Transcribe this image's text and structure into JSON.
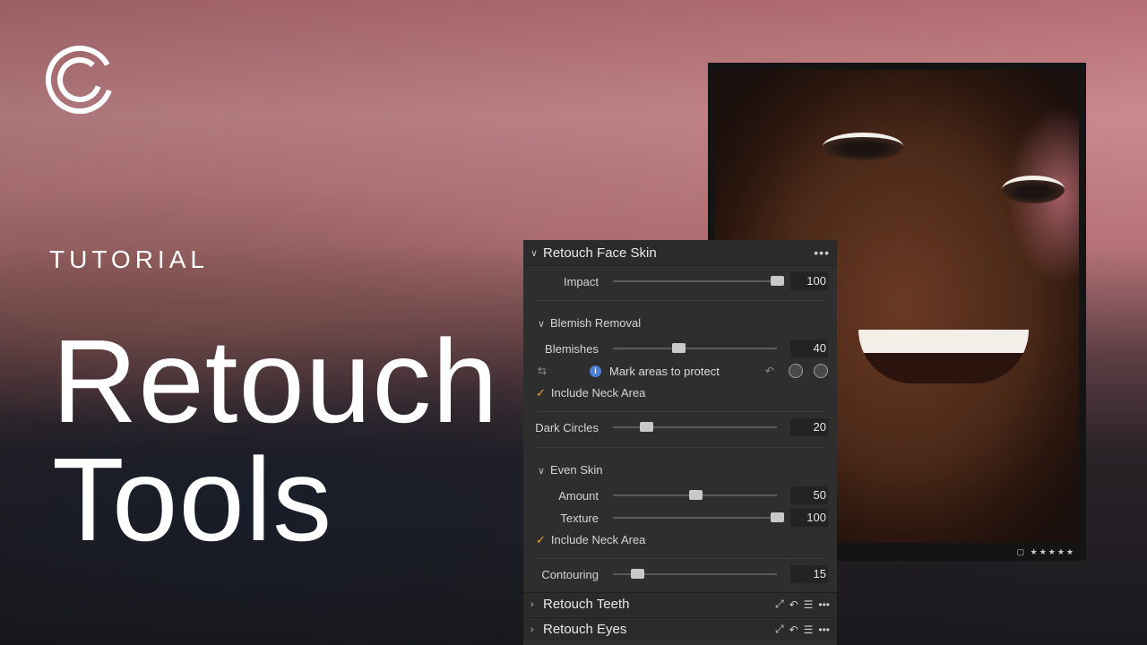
{
  "hero": {
    "tag": "TUTORIAL",
    "title_line1": "Retouch",
    "title_line2": "Tools"
  },
  "photo": {
    "rating": "▢ ★★★★★"
  },
  "panel": {
    "header": "Retouch Face Skin",
    "more": "•••",
    "impact": {
      "label": "Impact",
      "value": "100",
      "level": 1.0
    },
    "blemish_removal": {
      "title": "Blemish Removal",
      "blemishes": {
        "label": "Blemishes",
        "value": "40",
        "level": 0.4
      },
      "mark_areas": "Mark areas to protect",
      "include_neck": "Include Neck Area"
    },
    "dark_circles": {
      "label": "Dark Circles",
      "value": "20",
      "level": 0.2
    },
    "even_skin": {
      "title": "Even Skin",
      "amount": {
        "label": "Amount",
        "value": "50",
        "level": 0.5
      },
      "texture": {
        "label": "Texture",
        "value": "100",
        "level": 1.0
      },
      "include_neck": "Include Neck Area"
    },
    "contouring": {
      "label": "Contouring",
      "value": "15",
      "level": 0.15
    },
    "footer_tools": [
      {
        "label": "Retouch Teeth"
      },
      {
        "label": "Retouch Eyes"
      }
    ]
  },
  "colors": {
    "accent_check": "#f0a13a",
    "info_blue": "#4c7fd6"
  }
}
